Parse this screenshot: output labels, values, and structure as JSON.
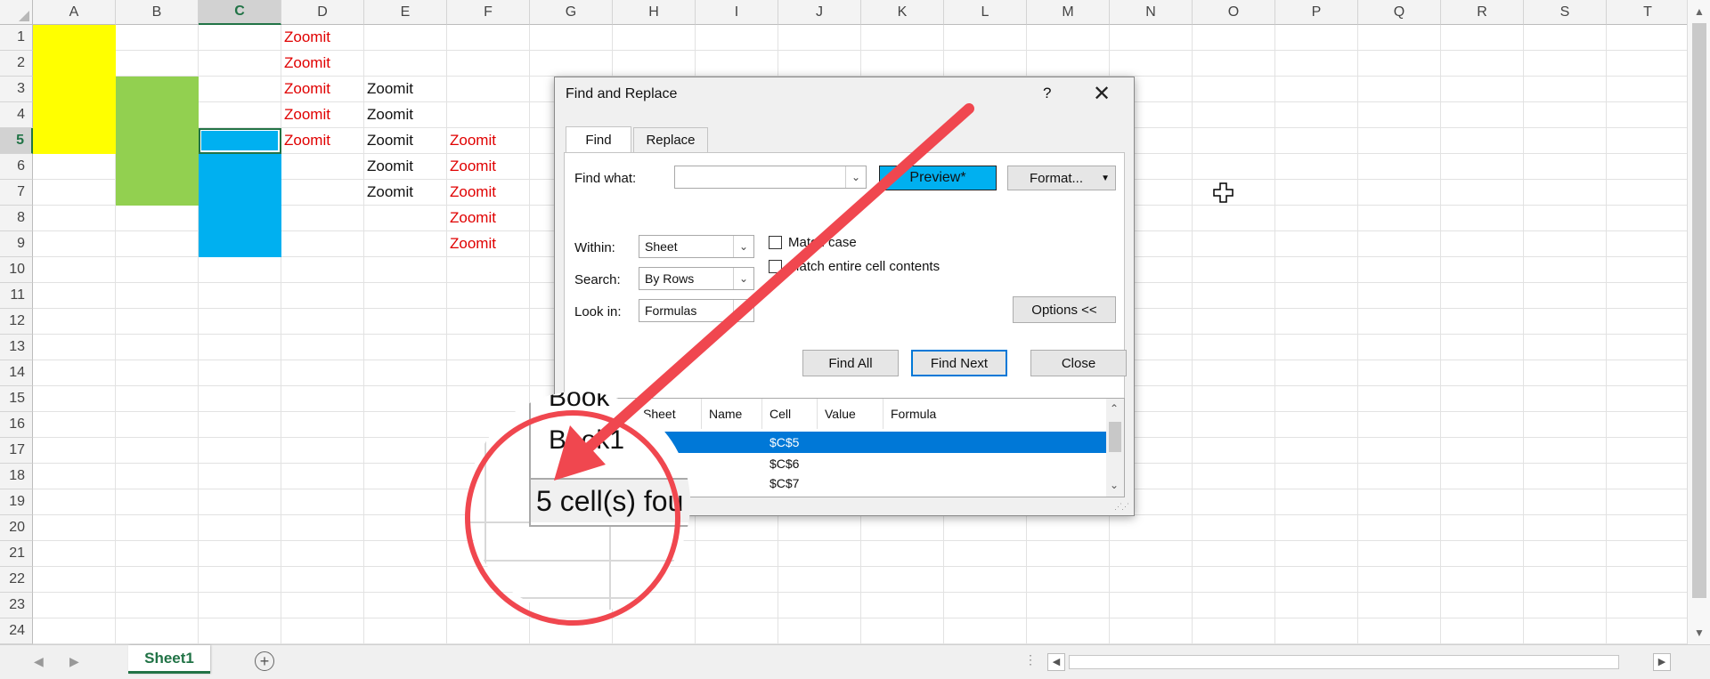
{
  "columns": [
    "A",
    "B",
    "C",
    "D",
    "E",
    "F",
    "G",
    "H",
    "I",
    "J",
    "K",
    "L",
    "M",
    "N",
    "O",
    "P",
    "Q",
    "R",
    "S",
    "T"
  ],
  "rows": [
    "1",
    "2",
    "3",
    "4",
    "5",
    "6",
    "7",
    "8",
    "9",
    "10",
    "11",
    "12",
    "13",
    "14",
    "15",
    "16",
    "17",
    "18",
    "19",
    "20",
    "21",
    "22",
    "23",
    "24"
  ],
  "selected_column": "C",
  "selected_row": "5",
  "cells": {
    "D1": "Zoomit",
    "D2": "Zoomit",
    "D3": "Zoomit",
    "D4": "Zoomit",
    "D5": "Zoomit",
    "E3": "Zoomit",
    "E4": "Zoomit",
    "E5": "Zoomit",
    "E6": "Zoomit",
    "E7": "Zoomit",
    "F5": "Zoomit",
    "F6": "Zoomit",
    "F7": "Zoomit",
    "F8": "Zoomit",
    "F9": "Zoomit"
  },
  "colors": {
    "yellow": "#ffff00",
    "green": "#92d050",
    "blue": "#00b0f0",
    "red_text": "#e00000",
    "excel_green": "#217346",
    "annotation_red": "#f0474f"
  },
  "sheet_tab": "Sheet1",
  "dialog": {
    "title": "Find and Replace",
    "help": "?",
    "close": "✕",
    "tabs": [
      "Find",
      "Replace"
    ],
    "find_what_label": "Find what:",
    "find_what_value": "",
    "preview_label": "Preview*",
    "format_label": "Format...",
    "within_label": "Within:",
    "within_value": "Sheet",
    "search_label": "Search:",
    "search_value": "By Rows",
    "look_in_label": "Look in:",
    "look_in_value": "Formulas",
    "match_case_label": "Match case",
    "match_entire_label": "Match entire cell contents",
    "options_label": "Options <<",
    "find_all_label": "Find All",
    "find_next_label": "Find Next",
    "close_label": "Close",
    "results_headers": [
      "Book",
      "Sheet",
      "Name",
      "Cell",
      "Value",
      "Formula"
    ],
    "results_rows": [
      {
        "cell": "$C$5",
        "selected": true
      },
      {
        "cell": "$C$6",
        "selected": false
      },
      {
        "cell": "$C$7",
        "selected": false
      }
    ]
  },
  "magnifier": {
    "book_1": "Book",
    "book_2": "Book1",
    "status": "5 cell(s) fou"
  }
}
